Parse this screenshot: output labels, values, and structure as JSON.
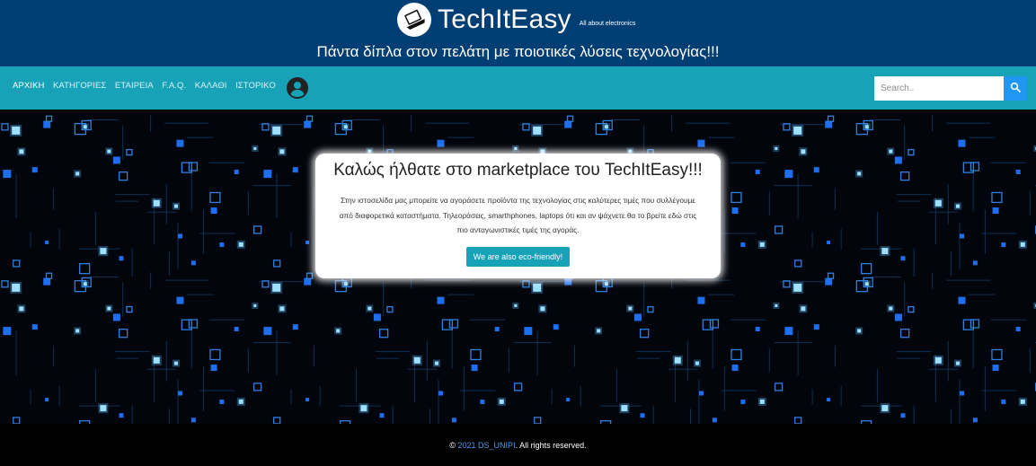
{
  "header": {
    "brand_name": "TechItEasy",
    "brand_tagline": "All about electronics",
    "slogan": "Πάντα δίπλα στον πελάτη με ποιοτικές λύσεις τεχνολογίας!!!",
    "logo_icon": "laptop-icon"
  },
  "nav": {
    "items": [
      {
        "label": "ΑΡΧΙΚΗ",
        "active": true
      },
      {
        "label": "ΚΑΤΗΓΟΡΙΕΣ",
        "active": false
      },
      {
        "label": "ΕΤΑΙΡΕΙΑ",
        "active": false
      },
      {
        "label": "F.A.Q.",
        "active": false
      },
      {
        "label": "ΚΑΛΑΘΙ",
        "active": false
      },
      {
        "label": "ΙΣΤΟΡΙΚΟ",
        "active": false
      }
    ],
    "account_icon": "account-circle-icon"
  },
  "search": {
    "placeholder": "Search..",
    "value": "",
    "button_icon": "search-icon"
  },
  "welcome": {
    "title": "Καλώς ήλθατε στο marketplace του TechItEasy!!!",
    "text": "Στην ιστοσελίδα μας μπορείτε να αγοράσετε προϊόντα της τεχνολογίας στις καλύτερες τιμές που συλλέγουμε από διαφορετικά καταστήματα. Τηλεοράσεις, smarthphones, laptops ότι και αν ψάχνετε θα το βρείτε εδώ στις πιο ανταγωνιστικές τιμές της αγοράς.",
    "button_label": "We are also eco-friendly!"
  },
  "footer": {
    "copyright_symbol": "©",
    "link_text": "2021 DS_UNIPI",
    "suffix": ". All rights reserved."
  },
  "colors": {
    "header_bg": "#003e73",
    "navbar_bg": "#18a2b8",
    "search_button": "#2196f3",
    "eco_button": "#17a2b8",
    "circuit_glow": "#2f8bff"
  }
}
